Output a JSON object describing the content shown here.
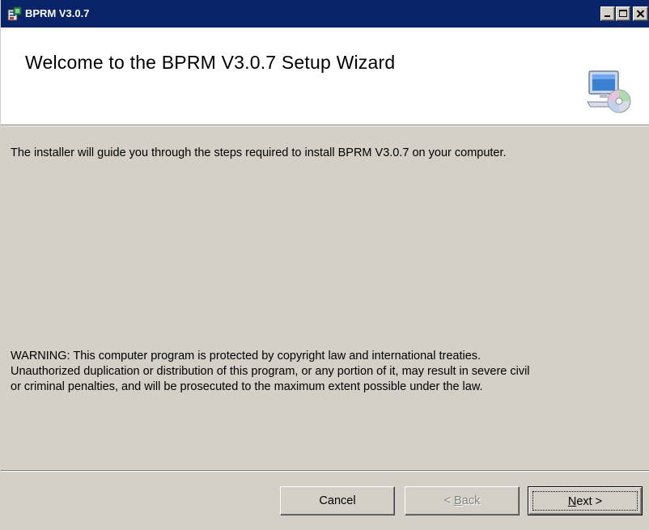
{
  "window": {
    "title": "BPRM V3.0.7",
    "app_icon": "installer-icon",
    "controls": {
      "minimize_icon": "minimize-icon",
      "maximize_icon": "maximize-icon",
      "close_icon": "close-icon"
    }
  },
  "banner": {
    "title": "Welcome to the BPRM V3.0.7 Setup Wizard",
    "icon": "computer-cd-icon"
  },
  "content": {
    "intro": "The installer will guide you through the steps required to install BPRM V3.0.7 on your computer.",
    "warning_lines": [
      "WARNING: This computer program is protected by copyright law and international treaties.",
      "Unauthorized duplication or distribution of this program, or any portion of it, may result in severe civil",
      "or criminal penalties, and will be prosecuted to the maximum extent possible under the law."
    ]
  },
  "buttons": {
    "cancel": "Cancel",
    "back_prefix": "< ",
    "back_accel": "B",
    "back_rest": "ack",
    "next_accel": "N",
    "next_rest": "ext >"
  },
  "colors": {
    "titlebar": "#0a246a",
    "face": "#d4d0c8",
    "banner": "#ffffff"
  }
}
